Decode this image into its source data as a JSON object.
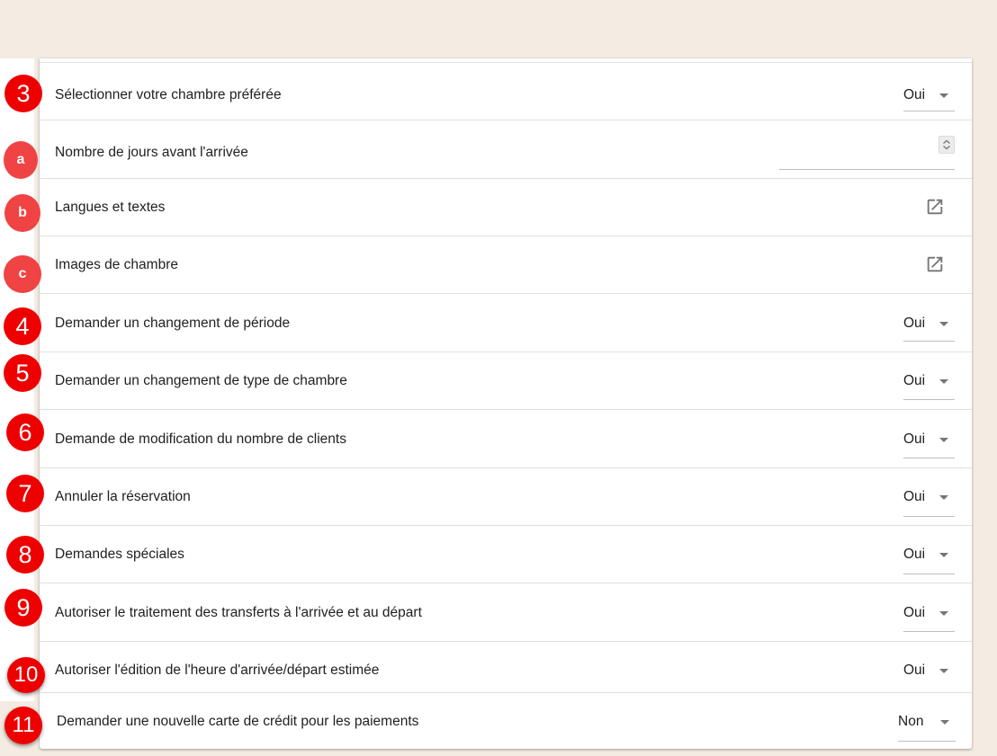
{
  "rows": [
    {
      "label": "Sélectionner votre chambre préférée",
      "value": "Oui"
    },
    {
      "label": "Nombre de jours avant l'arrivée"
    },
    {
      "label": "Langues et textes"
    },
    {
      "label": "Images de chambre"
    },
    {
      "label": "Demander un changement de période",
      "value": "Oui"
    },
    {
      "label": "Demander un changement de type de chambre",
      "value": "Oui"
    },
    {
      "label": "Demande de modification du nombre de clients",
      "value": "Oui"
    },
    {
      "label": "Annuler la réservation",
      "value": "Oui"
    },
    {
      "label": "Demandes spéciales",
      "value": "Oui"
    },
    {
      "label": "Autoriser le traitement des transferts à l'arrivée et au départ",
      "value": "Oui"
    },
    {
      "label": "Autoriser l'édition de l'heure d'arrivée/départ estimée",
      "value": "Oui"
    },
    {
      "label": "Demander une nouvelle carte de crédit pour les paiements",
      "value": "Non"
    }
  ],
  "badges": [
    "3",
    "a",
    "b",
    "c",
    "4",
    "5",
    "6",
    "7",
    "8",
    "9",
    "10",
    "11"
  ],
  "icons": {
    "external": "open-in-new-icon",
    "dropdown": "caret-down-icon",
    "spinner": "spinner-icon"
  },
  "colors": {
    "background": "#f4ebe2",
    "badge_red": "#ee0000",
    "badge_light_red": "#f04343"
  }
}
